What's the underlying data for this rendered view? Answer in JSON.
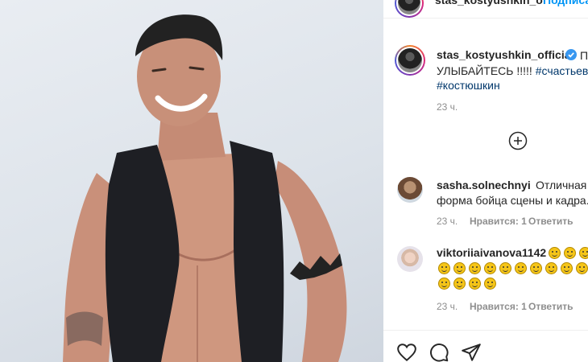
{
  "header": {
    "username": "stas_kostyushkin_o",
    "follow_label": "Подписа"
  },
  "post": {
    "author": "stas_kostyushkin_official",
    "caption_start": "ПР",
    "caption_line2": "УЛЫБАЙТЕСЬ !!!!! ",
    "hashtag1": "#счастьевсе",
    "hashtag2": "#костюшкин",
    "time": "23 ч."
  },
  "comments": [
    {
      "user": "sasha.solnechnyi",
      "text1": "Отличная",
      "text2": "форма бойца сцены и кадра.",
      "time": "23 ч.",
      "likes": "Нравится: 1",
      "reply": "Ответить"
    },
    {
      "user": "viktoriiaivanova1142",
      "time": "23 ч.",
      "likes": "Нравится: 1",
      "reply": "Ответить"
    }
  ],
  "icons": [
    "verified-icon",
    "load-more-icon",
    "heart-icon",
    "comment-icon",
    "share-icon"
  ],
  "colors": {
    "accent": "#0095f6",
    "hashtag": "#00376b",
    "meta": "#8e8e8e",
    "verified": "#3897f0"
  }
}
